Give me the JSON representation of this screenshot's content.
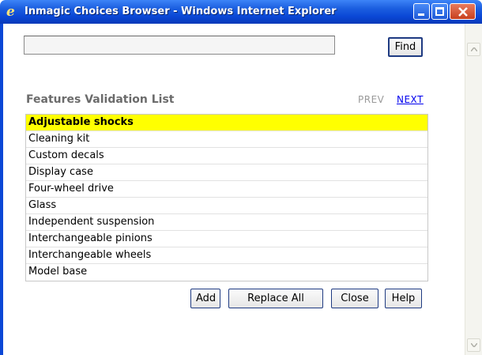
{
  "window": {
    "title": "Inmagic Choices Browser - Windows Internet Explorer",
    "app_icon": "ie-icon"
  },
  "search": {
    "value": "",
    "placeholder": "",
    "find_label": "Find"
  },
  "list": {
    "title": "Features Validation List",
    "prev_label": "PREV",
    "next_label": "NEXT",
    "items": [
      {
        "label": "Adjustable shocks",
        "selected": true
      },
      {
        "label": "Cleaning kit"
      },
      {
        "label": "Custom decals"
      },
      {
        "label": "Display case"
      },
      {
        "label": "Four-wheel drive"
      },
      {
        "label": "Glass"
      },
      {
        "label": "Independent suspension"
      },
      {
        "label": "Interchangeable pinions"
      },
      {
        "label": "Interchangeable wheels"
      },
      {
        "label": "Model base"
      }
    ]
  },
  "buttons": {
    "add": "Add",
    "replace_all": "Replace All",
    "close": "Close",
    "help": "Help"
  },
  "colors": {
    "selected_row": "#ffff00",
    "titlebar": "#0a47d6",
    "link": "#0000ee"
  }
}
